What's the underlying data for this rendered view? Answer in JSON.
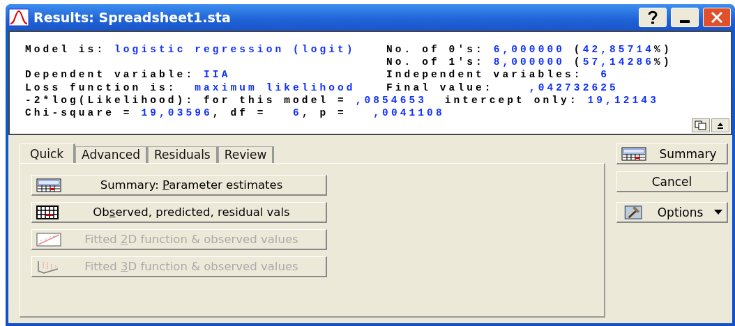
{
  "window": {
    "title": "Results: Spreadsheet1.sta"
  },
  "output": {
    "rows": [
      {
        "left": [
          {
            "kind": "label",
            "text": "Model is: "
          },
          {
            "kind": "value",
            "text": "logistic regression (logit)"
          }
        ],
        "right": [
          {
            "kind": "label",
            "text": "No. of 0's: "
          },
          {
            "kind": "value",
            "text": "6,000000"
          },
          {
            "kind": "label",
            "text": " ("
          },
          {
            "kind": "value",
            "text": "42,85714"
          },
          {
            "kind": "label",
            "text": "%)"
          }
        ]
      },
      {
        "left": [],
        "right": [
          {
            "kind": "label",
            "text": "No. of 1's: "
          },
          {
            "kind": "value",
            "text": "8,000000"
          },
          {
            "kind": "label",
            "text": " ("
          },
          {
            "kind": "value",
            "text": "57,14286"
          },
          {
            "kind": "label",
            "text": "%)"
          }
        ]
      },
      {
        "left": [
          {
            "kind": "label",
            "text": "Dependent variable: "
          },
          {
            "kind": "value",
            "text": "IIA"
          }
        ],
        "right": [
          {
            "kind": "label",
            "text": "Independent variables:  "
          },
          {
            "kind": "value",
            "text": "6"
          }
        ]
      },
      {
        "left": [
          {
            "kind": "label",
            "text": "Loss function is:  "
          },
          {
            "kind": "value",
            "text": "maximum likelihood"
          }
        ],
        "right": [
          {
            "kind": "label",
            "text": "Final value:    "
          },
          {
            "kind": "value",
            "text": ",042732625"
          }
        ]
      },
      {
        "left": [
          {
            "kind": "label",
            "text": "-2*log(Likelihood): for this model = "
          },
          {
            "kind": "value",
            "text": ",0854653"
          },
          {
            "kind": "label",
            "text": "  intercept only: "
          },
          {
            "kind": "value",
            "text": "19,12143"
          }
        ],
        "right": []
      },
      {
        "left": [
          {
            "kind": "label",
            "text": "Chi-square = "
          },
          {
            "kind": "value",
            "text": "19,03596"
          },
          {
            "kind": "label",
            "text": ", df =   "
          },
          {
            "kind": "value",
            "text": "6"
          },
          {
            "kind": "label",
            "text": ", p =   "
          },
          {
            "kind": "value",
            "text": ",0041108"
          }
        ],
        "right": []
      }
    ]
  },
  "tabs": [
    {
      "label": "Quick",
      "selected": true
    },
    {
      "label": "Advanced",
      "selected": false
    },
    {
      "label": "Residuals",
      "selected": false
    },
    {
      "label": "Review",
      "selected": false
    }
  ],
  "actions": [
    {
      "kind": "summary",
      "label": [
        "Summary: ",
        "P",
        "arameter estimates"
      ],
      "disabled": false
    },
    {
      "kind": "grid",
      "label": [
        "Ob",
        "s",
        "erved, predicted, residual vals"
      ],
      "disabled": false
    },
    {
      "kind": "plot2d",
      "label": [
        "Fitted ",
        "2",
        "D function & observed values"
      ],
      "disabled": true
    },
    {
      "kind": "plot3d",
      "label": [
        "Fitted ",
        "3",
        "D function & observed values"
      ],
      "disabled": true
    }
  ],
  "side_buttons": [
    {
      "kind": "summary",
      "label": "Summary"
    },
    {
      "kind": "plain",
      "label": "Cancel"
    },
    {
      "kind": "options",
      "label": "Options"
    }
  ]
}
